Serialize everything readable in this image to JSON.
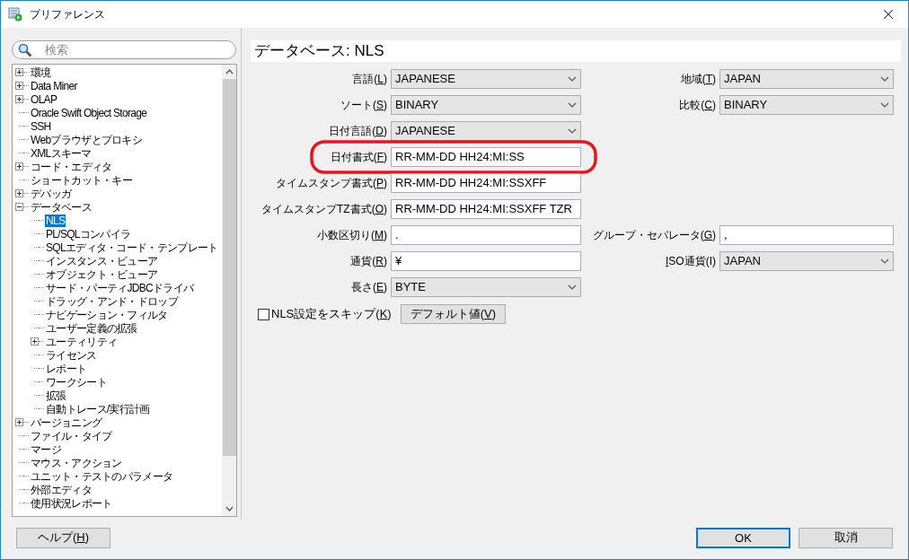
{
  "window": {
    "title": "プリファレンス"
  },
  "search": {
    "placeholder": "検索"
  },
  "tree": [
    {
      "label": "環境",
      "kind": "folder",
      "expanded": false,
      "selected": false
    },
    {
      "label": "Data Miner",
      "kind": "folder",
      "expanded": false,
      "selected": false
    },
    {
      "label": "OLAP",
      "kind": "folder",
      "expanded": false,
      "selected": false
    },
    {
      "label": "Oracle Swift Object Storage",
      "kind": "leaf",
      "selected": false
    },
    {
      "label": "SSH",
      "kind": "leaf",
      "selected": false
    },
    {
      "label": "Webブラウザとプロキシ",
      "kind": "leaf",
      "selected": false
    },
    {
      "label": "XMLスキーマ",
      "kind": "leaf",
      "selected": false
    },
    {
      "label": "コード・エディタ",
      "kind": "folder",
      "expanded": false,
      "selected": false
    },
    {
      "label": "ショートカット・キー",
      "kind": "leaf",
      "selected": false
    },
    {
      "label": "デバッガ",
      "kind": "folder",
      "expanded": false,
      "selected": false
    },
    {
      "label": "データベース",
      "kind": "folder",
      "expanded": true,
      "selected": false,
      "children": [
        {
          "label": "NLS",
          "kind": "leaf",
          "selected": true
        },
        {
          "label": "PL/SQLコンパイラ",
          "kind": "leaf",
          "selected": false
        },
        {
          "label": "SQLエディタ・コード・テンプレート",
          "kind": "leaf",
          "selected": false
        },
        {
          "label": "インスタンス・ビューア",
          "kind": "leaf",
          "selected": false
        },
        {
          "label": "オブジェクト・ビューア",
          "kind": "leaf",
          "selected": false
        },
        {
          "label": "サード・パーティJDBCドライバ",
          "kind": "leaf",
          "selected": false
        },
        {
          "label": "ドラッグ・アンド・ドロップ",
          "kind": "leaf",
          "selected": false
        },
        {
          "label": "ナビゲーション・フィルタ",
          "kind": "leaf",
          "selected": false
        },
        {
          "label": "ユーザー定義の拡張",
          "kind": "leaf",
          "selected": false
        },
        {
          "label": "ユーティリティ",
          "kind": "folder",
          "expanded": false,
          "selected": false
        },
        {
          "label": "ライセンス",
          "kind": "leaf",
          "selected": false
        },
        {
          "label": "レポート",
          "kind": "leaf",
          "selected": false
        },
        {
          "label": "ワークシート",
          "kind": "leaf",
          "selected": false
        },
        {
          "label": "拡張",
          "kind": "leaf",
          "selected": false
        },
        {
          "label": "自動トレース/実行計画",
          "kind": "leaf",
          "selected": false
        }
      ]
    },
    {
      "label": "バージョニング",
      "kind": "folder",
      "expanded": false,
      "selected": false
    },
    {
      "label": "ファイル・タイプ",
      "kind": "leaf",
      "selected": false
    },
    {
      "label": "マージ",
      "kind": "leaf",
      "selected": false
    },
    {
      "label": "マウス・アクション",
      "kind": "leaf",
      "selected": false
    },
    {
      "label": "ユニット・テストのパラメータ",
      "kind": "leaf",
      "selected": false
    },
    {
      "label": "外部エディタ",
      "kind": "leaf",
      "selected": false
    },
    {
      "label": "使用状況レポート",
      "kind": "leaf",
      "selected": false
    }
  ],
  "page_title": "データベース: NLS",
  "form_rows": [
    {
      "highlighted": false,
      "left": {
        "label": "言語(",
        "key": "L",
        "label_end": ")",
        "kind": "select",
        "value": "JAPANESE"
      },
      "right": {
        "label": "地域(",
        "key": "T",
        "label_end": ")",
        "kind": "select",
        "value": "JAPAN"
      }
    },
    {
      "highlighted": false,
      "left": {
        "label": "ソート(",
        "key": "S",
        "label_end": ")",
        "kind": "select",
        "value": "BINARY"
      },
      "right": {
        "label": "比較(",
        "key": "C",
        "label_end": ")",
        "kind": "select",
        "value": "BINARY"
      }
    },
    {
      "highlighted": false,
      "left": {
        "label": "日付言語(",
        "key": "D",
        "label_end": ")",
        "kind": "select",
        "value": "JAPANESE"
      }
    },
    {
      "highlighted": true,
      "left": {
        "label": "日付書式(",
        "key": "F",
        "label_end": ")",
        "kind": "text",
        "value": "RR-MM-DD HH24:MI:SS"
      }
    },
    {
      "highlighted": false,
      "left": {
        "label": "タイムスタンプ書式(",
        "key": "P",
        "label_end": ")",
        "kind": "text",
        "value": "RR-MM-DD HH24:MI:SSXFF"
      }
    },
    {
      "highlighted": false,
      "left": {
        "label": "タイムスタンプTZ書式(",
        "key": "O",
        "label_end": ")",
        "kind": "text",
        "value": "RR-MM-DD HH24:MI:SSXFF TZR"
      }
    },
    {
      "highlighted": false,
      "left": {
        "label": "小数区切り(",
        "key": "M",
        "label_end": ")",
        "kind": "text",
        "value": "."
      },
      "right": {
        "label": "グループ・セパレータ(",
        "key": "G",
        "label_end": ")",
        "kind": "text",
        "value": ","
      }
    },
    {
      "highlighted": false,
      "left": {
        "label": "通貨(",
        "key": "R",
        "label_end": ")",
        "kind": "text",
        "value": "¥"
      },
      "right": {
        "key": "I",
        "label_end": "SO通貨(I)",
        "kind": "select",
        "value": "JAPAN"
      }
    },
    {
      "highlighted": false,
      "left": {
        "label": "長さ(",
        "key": "E",
        "label_end": ")",
        "kind": "select",
        "value": "BYTE"
      }
    }
  ],
  "skip_checkbox": {
    "label": "NLS設定をスキップ(",
    "key": "K",
    "label_end": ")",
    "checked": false
  },
  "default_button": {
    "label": "デフォルト値(",
    "key": "V",
    "label_end": ")"
  },
  "help_button": {
    "label": "ヘルプ(",
    "key": "H",
    "label_end": ")"
  },
  "ok_button": {
    "label": "OK",
    "default": true
  },
  "cancel_button": {
    "label": "取消"
  }
}
